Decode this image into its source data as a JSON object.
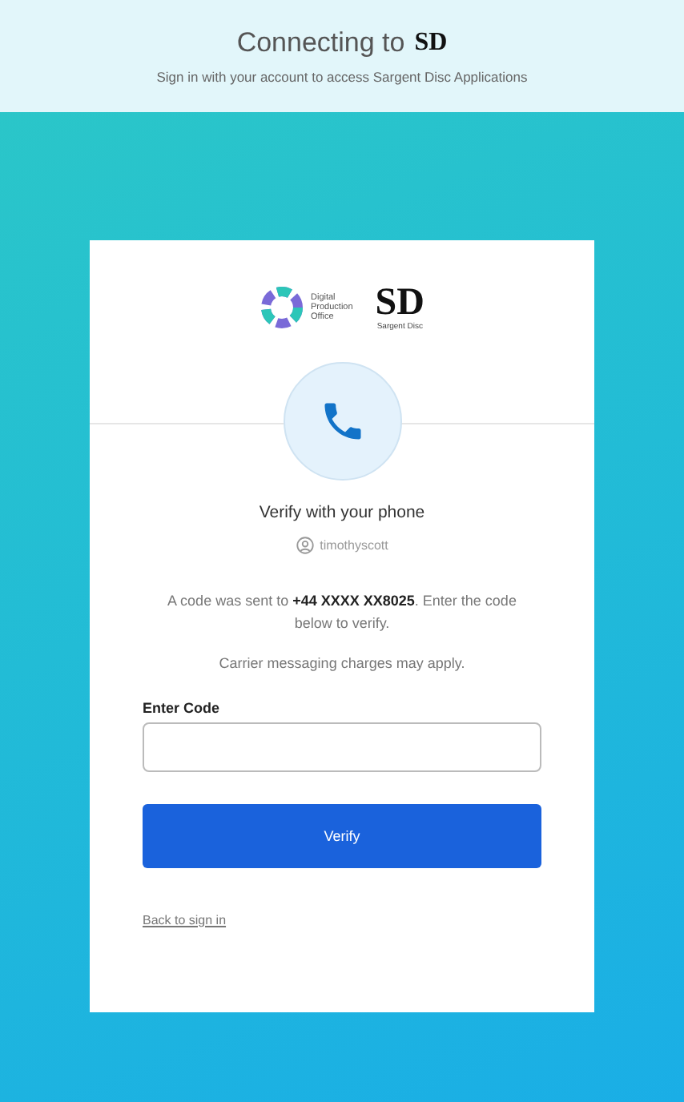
{
  "header": {
    "title": "Connecting to",
    "title_logo": "SD",
    "subtitle": "Sign in with your account to access Sargent Disc Applications"
  },
  "card": {
    "logos": [
      {
        "kind": "ring",
        "lines": [
          "Digital",
          "Production",
          "Office"
        ]
      },
      {
        "kind": "monogram",
        "mark": "SD",
        "caption": "Sargent Disc"
      }
    ],
    "title": "Verify with your phone",
    "username": "timothyscott",
    "message": "A code was sent to **+44 XXXX XX8025**. Enter the code below to verify.",
    "notice": "Carrier messaging charges may apply.",
    "code_field": {
      "label": "Enter Code"
    },
    "button": "Verify",
    "back_link": "Back to sign in"
  }
}
